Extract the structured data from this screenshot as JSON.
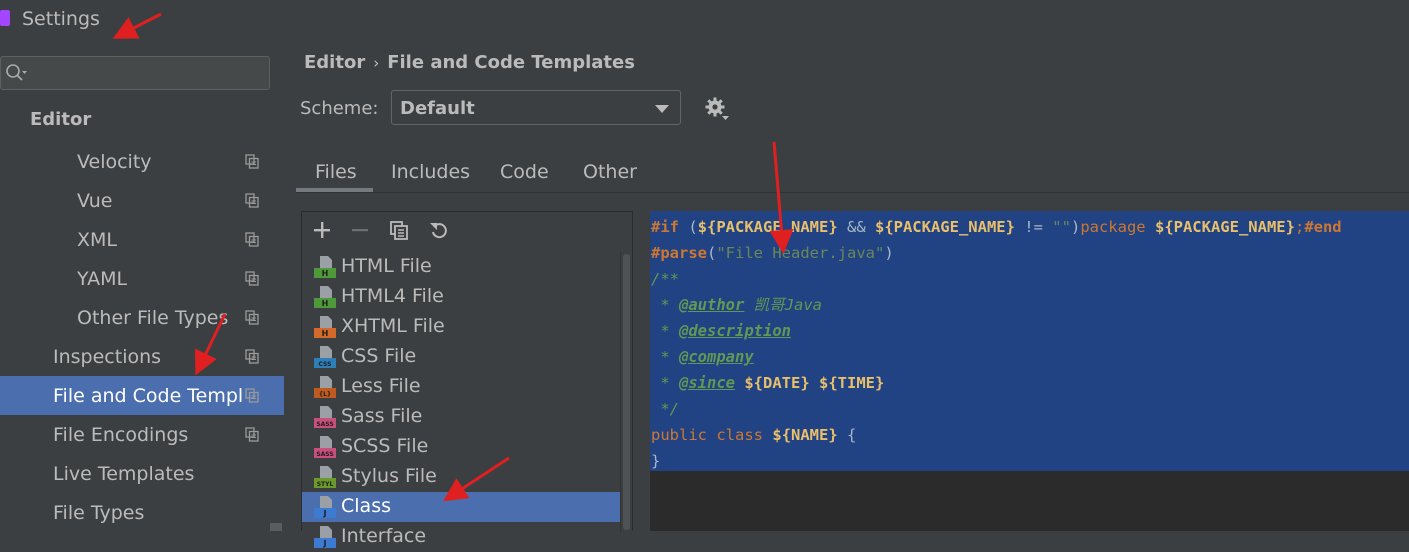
{
  "window": {
    "title": "Settings"
  },
  "sidebar": {
    "search_placeholder": "",
    "section_header": "Editor",
    "items": [
      {
        "label": "Velocity",
        "indent": 2,
        "has_copy": true
      },
      {
        "label": "Vue",
        "indent": 2,
        "has_copy": true
      },
      {
        "label": "XML",
        "indent": 2,
        "has_copy": true
      },
      {
        "label": "YAML",
        "indent": 2,
        "has_copy": true
      },
      {
        "label": "Other File Types",
        "indent": 2,
        "has_copy": true
      },
      {
        "label": "Inspections",
        "indent": 1,
        "has_copy": true
      },
      {
        "label": "File and Code Templa",
        "indent": 1,
        "has_copy": true,
        "selected": true
      },
      {
        "label": "File Encodings",
        "indent": 1,
        "has_copy": true
      },
      {
        "label": "Live Templates",
        "indent": 1,
        "has_copy": false
      },
      {
        "label": "File Types",
        "indent": 1,
        "has_copy": false
      }
    ]
  },
  "main": {
    "breadcrumb": {
      "parent": "Editor",
      "separator": "›",
      "current": "File and Code Templates"
    },
    "scheme": {
      "label": "Scheme:",
      "value": "Default"
    },
    "tabs": [
      {
        "label": "Files",
        "active": true
      },
      {
        "label": "Includes",
        "active": false
      },
      {
        "label": "Code",
        "active": false
      },
      {
        "label": "Other",
        "active": false
      }
    ],
    "toolbar": {
      "add": "plus-icon",
      "remove": "minus-icon",
      "copy": "copy-icon",
      "reset": "reset-icon"
    },
    "templates": [
      {
        "label": "HTML File",
        "badge": "H",
        "color": "#4e9a3a"
      },
      {
        "label": "HTML4 File",
        "badge": "H",
        "color": "#4e9a3a"
      },
      {
        "label": "XHTML File",
        "badge": "H",
        "color": "#d46a2a"
      },
      {
        "label": "CSS File",
        "badge": "CSS",
        "color": "#2d7fb8"
      },
      {
        "label": "Less File",
        "badge": "{L}",
        "color": "#c05a1e"
      },
      {
        "label": "Sass File",
        "badge": "SASS",
        "color": "#c94f7c"
      },
      {
        "label": "SCSS File",
        "badge": "SASS",
        "color": "#c94f7c"
      },
      {
        "label": "Stylus File",
        "badge": "STYL",
        "color": "#6a9a2a"
      },
      {
        "label": "Class",
        "badge": "J",
        "color": "#3d7ad1",
        "selected": true
      },
      {
        "label": "Interface",
        "badge": "J",
        "color": "#3d7ad1"
      }
    ],
    "code_lines": [
      [
        {
          "c": "dir",
          "t": "#if"
        },
        {
          "c": "plain",
          "t": " ("
        },
        {
          "c": "var",
          "t": "${PACKAGE_NAME}"
        },
        {
          "c": "plain",
          "t": " && "
        },
        {
          "c": "var",
          "t": "${PACKAGE_NAME}"
        },
        {
          "c": "plain",
          "t": " != "
        },
        {
          "c": "str",
          "t": "\"\""
        },
        {
          "c": "plain",
          "t": ")"
        },
        {
          "c": "kw",
          "t": "package"
        },
        {
          "c": "plain",
          "t": " "
        },
        {
          "c": "var",
          "t": "${PACKAGE_NAME}"
        },
        {
          "c": "kw",
          "t": ";"
        },
        {
          "c": "dir",
          "t": "#end"
        }
      ],
      [
        {
          "c": "dir",
          "t": "#parse"
        },
        {
          "c": "plain",
          "t": "("
        },
        {
          "c": "str",
          "t": "\"File Header.java\""
        },
        {
          "c": "plain",
          "t": ")"
        }
      ],
      [
        {
          "c": "doc",
          "t": "/**"
        }
      ],
      [
        {
          "c": "doc",
          "t": " * "
        },
        {
          "c": "tag",
          "t": "@author"
        },
        {
          "c": "doc",
          "t": " 凯哥Java"
        }
      ],
      [
        {
          "c": "doc",
          "t": " * "
        },
        {
          "c": "tag",
          "t": "@description"
        }
      ],
      [
        {
          "c": "doc",
          "t": " * "
        },
        {
          "c": "tag",
          "t": "@company"
        }
      ],
      [
        {
          "c": "doc",
          "t": " * "
        },
        {
          "c": "tag",
          "t": "@since"
        },
        {
          "c": "doc",
          "t": " "
        },
        {
          "c": "var",
          "t": "${DATE}"
        },
        {
          "c": "doc",
          "t": " "
        },
        {
          "c": "var",
          "t": "${TIME}"
        }
      ],
      [
        {
          "c": "doc",
          "t": " */"
        }
      ],
      [
        {
          "c": "kw",
          "t": "public"
        },
        {
          "c": "plain",
          "t": " "
        },
        {
          "c": "kw",
          "t": "class"
        },
        {
          "c": "plain",
          "t": " "
        },
        {
          "c": "var",
          "t": "${NAME}"
        },
        {
          "c": "plain",
          "t": " {"
        }
      ],
      [
        {
          "c": "plain",
          "t": "}"
        }
      ]
    ]
  },
  "colors": {
    "accent": "#4b6eaf",
    "selection": "#214283",
    "annotation_arrow": "#e02020"
  }
}
